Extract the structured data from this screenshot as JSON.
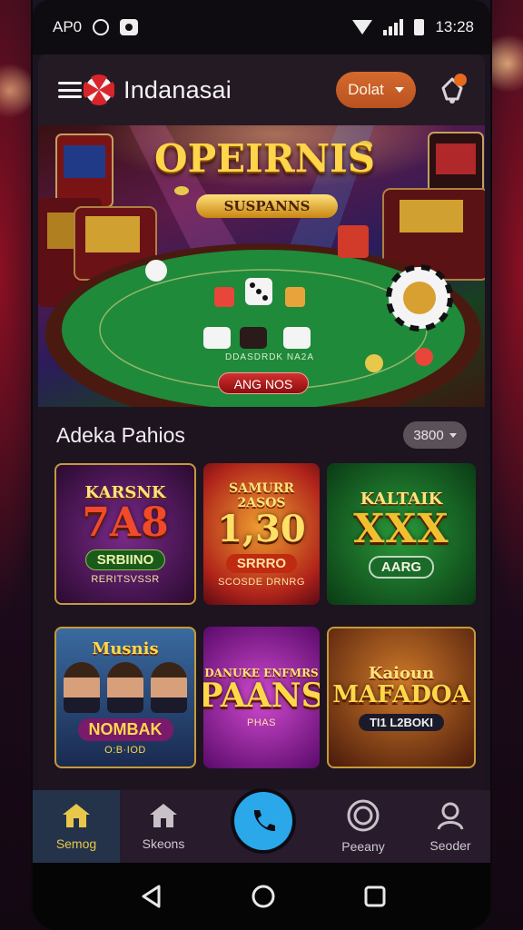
{
  "status_bar": {
    "carrier": "AP0",
    "time": "13:28"
  },
  "header": {
    "app_title": "Indanasai",
    "deposit_label": "Dolat",
    "menu_icon": "menu-icon",
    "notification_icon": "bell-icon"
  },
  "hero": {
    "title": "OPEIRNIS",
    "subtitle": "SUSPANNS",
    "table_text": "DDASDRDK NA2A",
    "cta_label": "ANG NOS"
  },
  "section": {
    "title": "Adeka Pahios",
    "filter_value": "3800"
  },
  "games": [
    {
      "top": "KARSNK",
      "big": "7A8",
      "badge": "SRBIINO",
      "foot": "RERITSVSSR"
    },
    {
      "top": "SAMURR 2ASOS",
      "big": "1,30",
      "badge": "SRRRO",
      "foot": "SCOSDE DRNRG"
    },
    {
      "top": "KALTAIK",
      "big": "XXX",
      "badge": "AARG",
      "foot": ""
    },
    {
      "top": "Musnis",
      "big": "",
      "badge": "NOMBAK",
      "foot": "O:B·IOD"
    },
    {
      "top": "DANUKE ENFMRS",
      "big": "PAANS",
      "badge": "",
      "foot": "PHAS"
    },
    {
      "top": "Kaioun",
      "big": "MAFADOA",
      "badge": "",
      "foot": "TI1 L2BOKI"
    }
  ],
  "bottom_nav": {
    "items": [
      {
        "label": "Semog",
        "icon": "home-icon"
      },
      {
        "label": "Skeons",
        "icon": "house-icon"
      },
      {
        "label": "Peeany",
        "icon": "chip-icon"
      },
      {
        "label": "Seoder",
        "icon": "person-icon"
      }
    ],
    "center_icon": "phone-icon"
  },
  "colors": {
    "accent": "#c25a24",
    "active_nav": "#e8c84a",
    "call_button": "#2aa8ea"
  }
}
